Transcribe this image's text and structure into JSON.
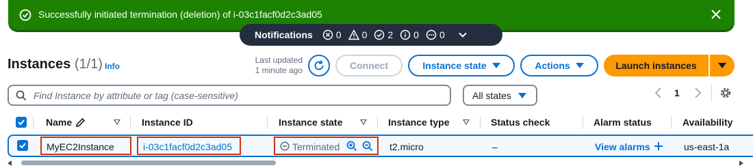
{
  "banner": {
    "message": "Successfully initiated termination (deletion) of i-03c1facf0d2c3ad05",
    "color": "#1d8102"
  },
  "notifications": {
    "title": "Notifications",
    "error_count": "0",
    "warning_count": "0",
    "success_count": "2",
    "info_count": "0",
    "in_progress_count": "0"
  },
  "header": {
    "title": "Instances",
    "count": "(1/1)",
    "info": "Info",
    "last_updated_line1": "Last updated",
    "last_updated_line2": "1 minute ago",
    "connect": "Connect",
    "instance_state": "Instance state",
    "actions": "Actions",
    "launch": "Launch instances"
  },
  "filter": {
    "placeholder": "Find Instance by attribute or tag (case-sensitive)",
    "states": "All states",
    "page": "1"
  },
  "table": {
    "columns": {
      "name": "Name",
      "instance_id": "Instance ID",
      "instance_state": "Instance state",
      "instance_type": "Instance type",
      "status_check": "Status check",
      "alarm_status": "Alarm status",
      "availability": "Availability"
    },
    "rows": [
      {
        "name": "MyEC2Instance",
        "instance_id": "i-03c1facf0d2c3ad05",
        "state": "Terminated",
        "type": "t2.micro",
        "status_check": "–",
        "alarm": "View alarms",
        "az": "us-east-1a"
      }
    ]
  },
  "colors": {
    "accent": "#0972d3",
    "primary_button": "#ff9900",
    "highlight_box": "#d13212",
    "notification_bg": "#232f3e"
  }
}
